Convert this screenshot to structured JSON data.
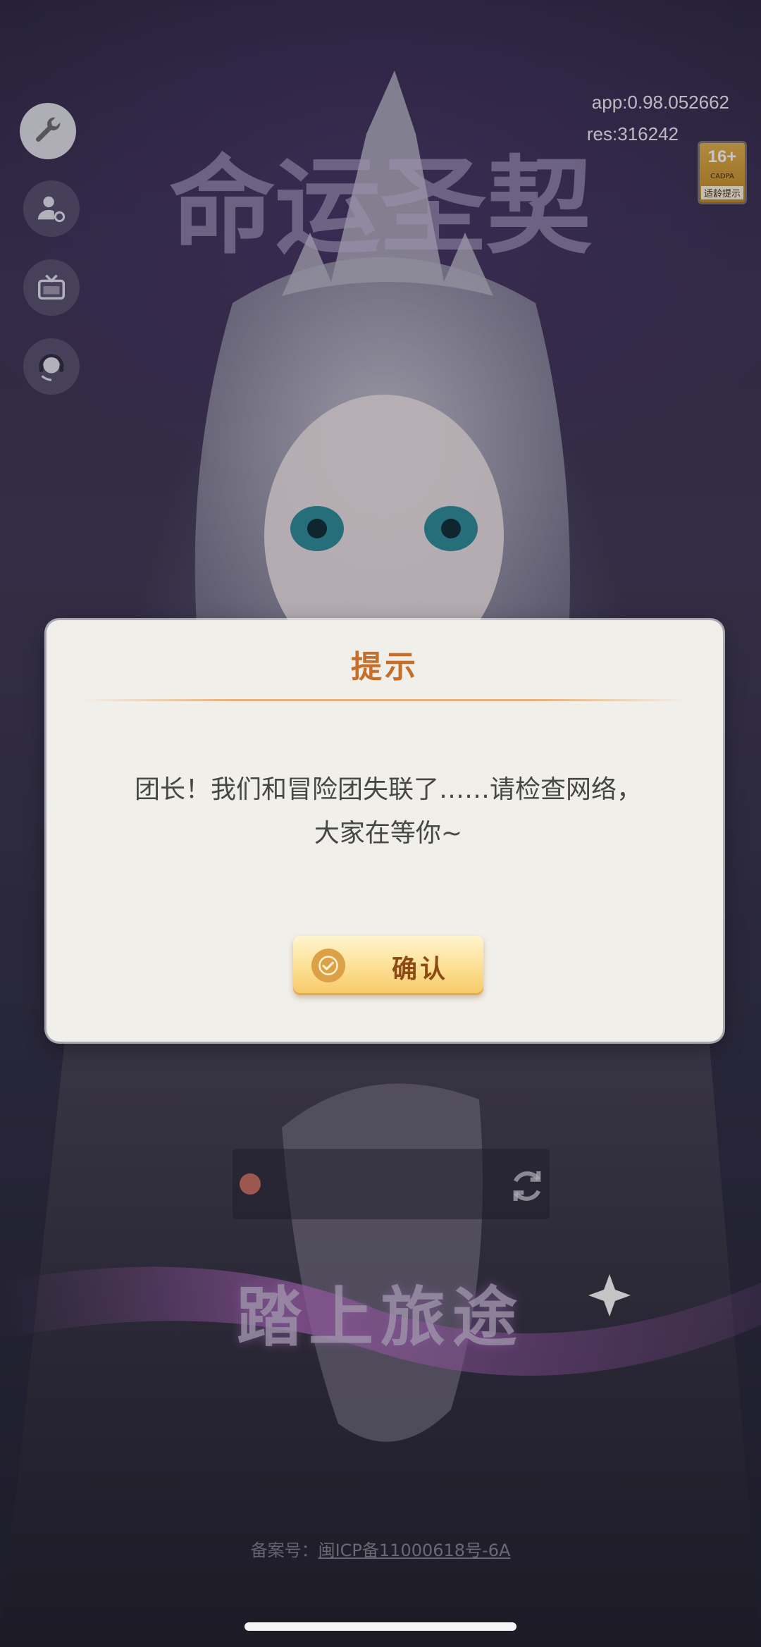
{
  "app": {
    "logo_text": "命运圣契",
    "version_text": "app:0.98.052662",
    "res_text": "res:316242",
    "age_rating": {
      "number": "16+",
      "org": "CADPA",
      "label": "适龄提示"
    }
  },
  "side_menu": [
    {
      "icon": "wrench-icon",
      "label": ""
    },
    {
      "icon": "user-settings-icon",
      "label": ""
    },
    {
      "icon": "tv-icon",
      "label": ""
    },
    {
      "icon": "headset-icon",
      "label": ""
    }
  ],
  "dialog": {
    "title": "提示",
    "message": "团长！我们和冒险团失联了……请检查网络，大家在等你~",
    "confirm_label": "确认"
  },
  "background_ui": {
    "start_button": "踏上旅途",
    "icp_prefix": "备案号：",
    "icp_link": "闽ICP备11000618号-6A"
  },
  "colors": {
    "title_accent": "#c56f2a",
    "dialog_bg": "#f1efea",
    "confirm_text": "#8c4a14"
  }
}
